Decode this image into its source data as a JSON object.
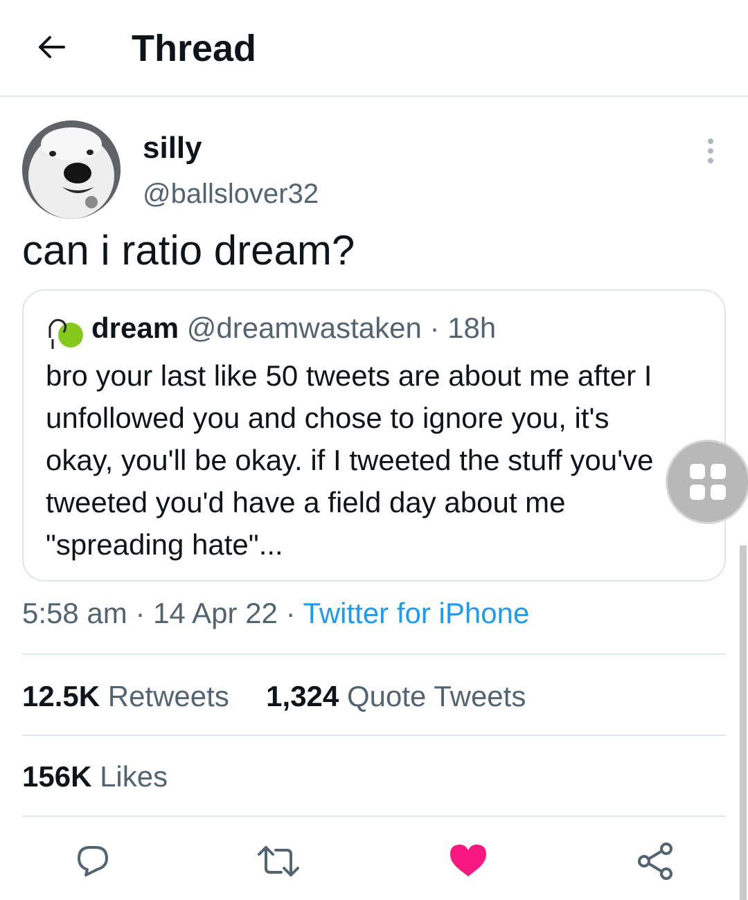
{
  "header": {
    "title": "Thread",
    "back_icon": "arrow-left-icon"
  },
  "tweet": {
    "author_name": "silly",
    "author_handle": "@ballslover32",
    "text": "can i ratio dream?",
    "timestamp": "5:58 am",
    "separator": " · ",
    "date": "14 Apr 22",
    "source": "Twitter for iPhone"
  },
  "quote": {
    "author_name": "dream",
    "author_handle": "@dreamwastaken",
    "separator": " · ",
    "time_ago": "18h",
    "text": "bro your last like 50 tweets are about me after I unfollowed you and chose to ignore you, it's okay, you'll be okay. if I tweeted the stuff you've tweeted you'd have a field day about me \"spreading hate\"..."
  },
  "stats": {
    "retweets_count": "12.5K",
    "retweets_label": " Retweets",
    "quotes_count": "1,324",
    "quotes_label": " Quote Tweets",
    "likes_count": "156K",
    "likes_label": " Likes"
  },
  "actions": [
    "reply-icon",
    "retweet-icon",
    "like-icon",
    "share-icon"
  ],
  "colors": {
    "link": "#1d9bf0",
    "like": "#f91880",
    "muted": "#536471",
    "text": "#0f1419"
  }
}
